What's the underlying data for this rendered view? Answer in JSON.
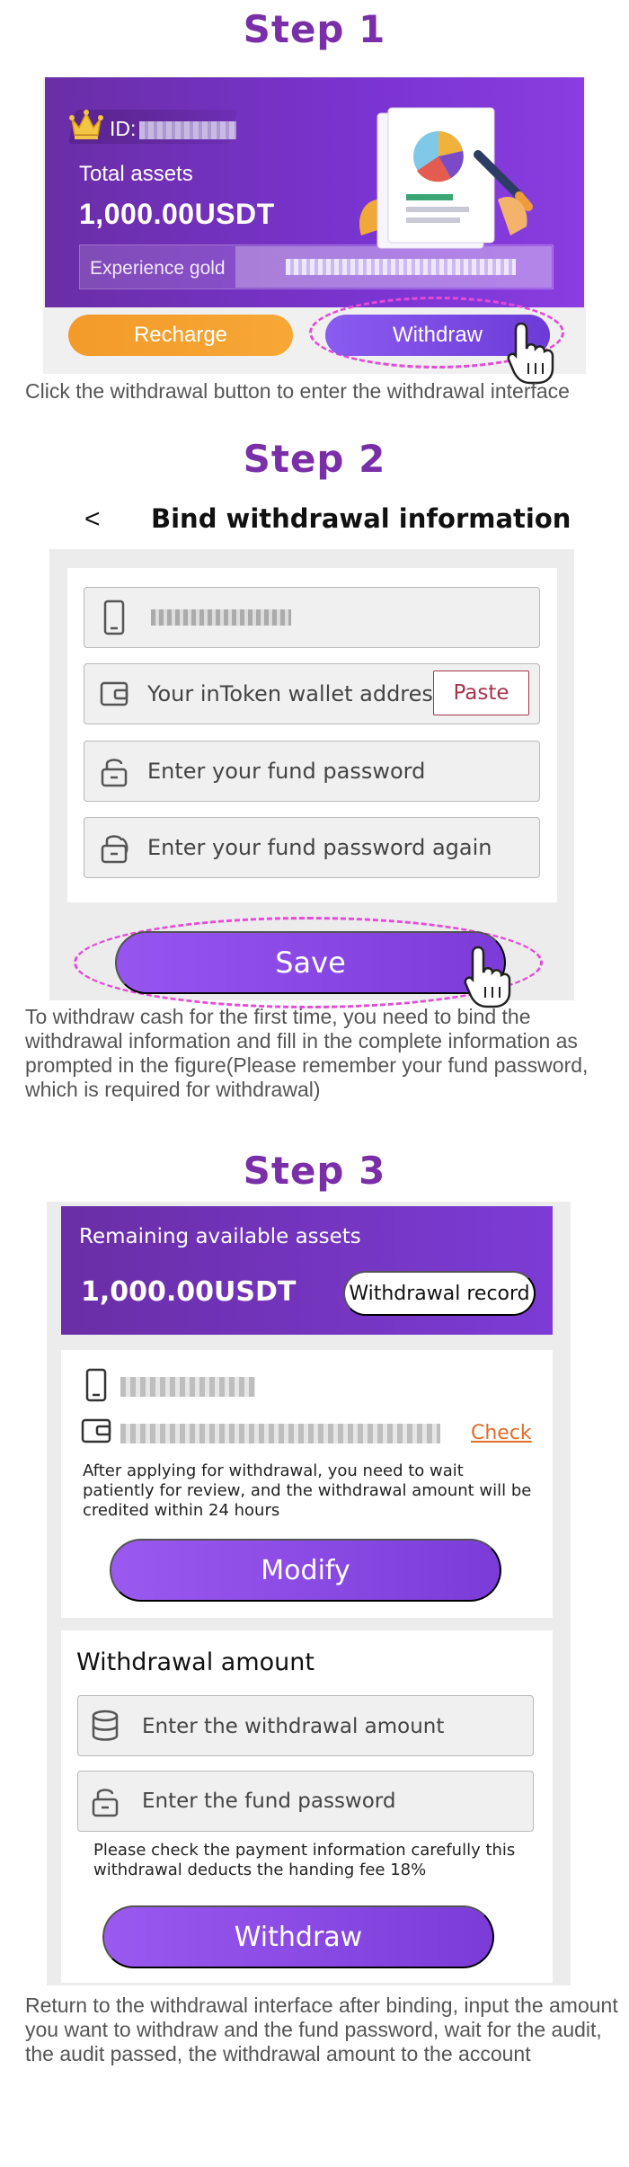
{
  "step1": {
    "title": "Step 1",
    "id_label": "ID:",
    "total_assets_label": "Total assets",
    "total_assets_value": "1,000.00USDT",
    "experience_label": "Experience gold",
    "recharge_label": "Recharge",
    "withdraw_label": "Withdraw",
    "caption": "Click the withdrawal button to enter the withdrawal interface"
  },
  "step2": {
    "title": "Step 2",
    "back_symbol": "<",
    "header_title": "Bind withdrawal information",
    "wallet_placeholder": "Your inToken wallet address",
    "paste_label": "Paste",
    "fund_password_placeholder": "Enter your fund password",
    "fund_password_again_placeholder": "Enter your fund password again",
    "save_label": "Save",
    "caption": "To withdraw cash for the first time, you need to bind the withdrawal information and fill in the complete information as prompted in the figure(Please remember your fund password, which is required for withdrawal)"
  },
  "step3": {
    "title": "Step 3",
    "remaining_label": "Remaining available assets",
    "remaining_value": "1,000.00USDT",
    "record_label": "Withdrawal record",
    "check_label": "Check",
    "review_note": "After applying for withdrawal, you need to wait patiently for review, and the withdrawal amount will be credited within 24 hours",
    "modify_label": "Modify",
    "amount_title": "Withdrawal amount",
    "amount_placeholder": "Enter the withdrawal amount",
    "fund_password_placeholder": "Enter the fund password",
    "fee_note": "Please check the payment information carefully this withdrawal deducts the handing fee 18%",
    "withdraw_label": "Withdraw",
    "caption": "Return to the withdrawal interface after binding, input the amount you want to withdraw and the fund password, wait for the audit, the audit passed, the withdrawal amount to the account"
  },
  "colors": {
    "step_title": "#7a2fa8",
    "purple_card": "#6a2ea6",
    "button_purple": "#7b3bd8",
    "recharge_orange": "#f39a2a",
    "highlight_dash": "#e64ad8",
    "paste_red": "#a7344e",
    "check_orange": "#e06d2a"
  },
  "icons": {
    "crown": "crown-icon",
    "phone": "phone-icon",
    "wallet": "wallet-icon",
    "lock": "lock-icon",
    "lock_refresh": "lock-repeat-icon",
    "database": "database-icon",
    "hand_pointer": "hand-pointer-icon"
  }
}
